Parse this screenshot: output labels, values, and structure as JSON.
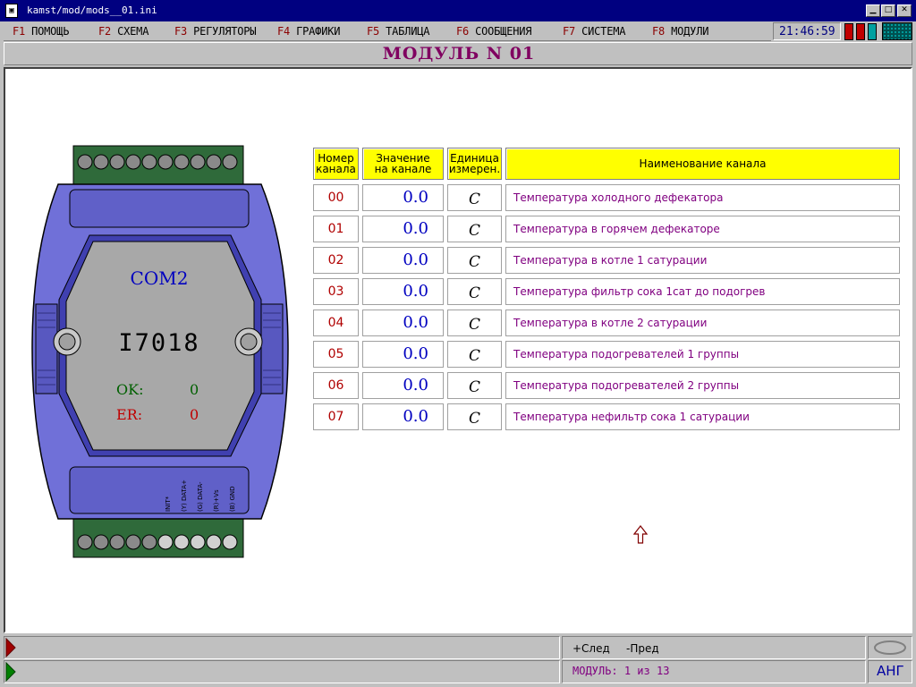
{
  "window": {
    "title": "kamst/mod/mods__01.ini",
    "icon": "app-icon"
  },
  "menu": [
    {
      "key": "F1",
      "label": "ПОМОЩЬ"
    },
    {
      "key": "F2",
      "label": "СХЕМА"
    },
    {
      "key": "F3",
      "label": "РЕГУЛЯТОРЫ"
    },
    {
      "key": "F4",
      "label": "ГРАФИКИ"
    },
    {
      "key": "F5",
      "label": "ТАБЛИЦА"
    },
    {
      "key": "F6",
      "label": "СООБЩЕНИЯ"
    },
    {
      "key": "F7",
      "label": "СИСТЕМА"
    },
    {
      "key": "F8",
      "label": "МОДУЛИ"
    }
  ],
  "clock": "21:46:59",
  "indicators": [
    {
      "name": "red-indicator-1",
      "color": "#c00000"
    },
    {
      "name": "red-indicator-2",
      "color": "#c00000"
    },
    {
      "name": "cyan-indicator",
      "color": "#00a0a0"
    }
  ],
  "header": {
    "title": "МОДУЛЬ  N  01"
  },
  "device": {
    "port": "COM2",
    "model": "I7018",
    "ok_label": "OK:",
    "ok_value": "0",
    "er_label": "ER:",
    "er_value": "0",
    "pins": [
      "INIT*",
      "(Y) DATA+",
      "(G) DATA-",
      "(R)+Vs",
      "(B) GND"
    ],
    "colors": {
      "body": "#7070d8",
      "inner": "#a8a8a8",
      "terminal": "#2f6a3a",
      "ok": "#006000",
      "er": "#c00000",
      "port": "#0000c0"
    }
  },
  "table": {
    "headers": {
      "number": [
        "Номер",
        "канала"
      ],
      "value": [
        "Значение",
        "на канале"
      ],
      "unit": [
        "Единица",
        "измерен."
      ],
      "name": "Наименование канала"
    },
    "rows": [
      {
        "num": "00",
        "value": "0.0",
        "unit": "C",
        "name": "Температура холодного дефекатора"
      },
      {
        "num": "01",
        "value": "0.0",
        "unit": "C",
        "name": "Температура в горячем дефекаторе"
      },
      {
        "num": "02",
        "value": "0.0",
        "unit": "C",
        "name": "Температура в котле 1 сатурации"
      },
      {
        "num": "03",
        "value": "0.0",
        "unit": "C",
        "name": "Температура фильтр сока 1сат до подогрев"
      },
      {
        "num": "04",
        "value": "0.0",
        "unit": "C",
        "name": "Температура в котле 2 сатурации"
      },
      {
        "num": "05",
        "value": "0.0",
        "unit": "C",
        "name": "Температура подогревателей 1 группы"
      },
      {
        "num": "06",
        "value": "0.0",
        "unit": "C",
        "name": "Температура подогревателей 2 группы"
      },
      {
        "num": "07",
        "value": "0.0",
        "unit": "C",
        "name": "Температура нефильтр сока 1 сатурации"
      }
    ]
  },
  "statusbar": {
    "next": "+След",
    "prev": "-Пред",
    "module_label": "МОДУЛЬ:",
    "module_current": "1",
    "module_of": "из",
    "module_total": "13",
    "lang": "АНГ"
  }
}
